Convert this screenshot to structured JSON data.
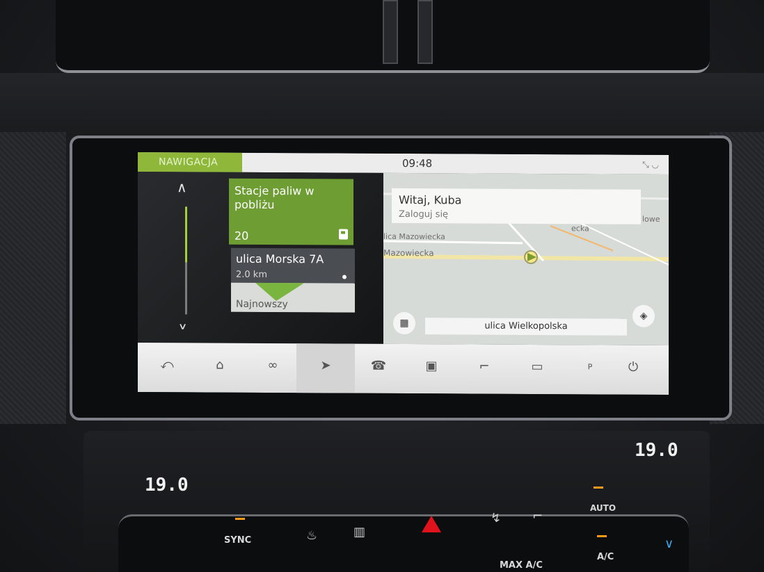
{
  "status": {
    "tab": "NAWIGACJA",
    "time": "09:48",
    "icons": "⤡ ◡"
  },
  "sidebar": {
    "up_icon": "chevron-up-icon",
    "down_icon": "chevron-down-icon",
    "scroll_fraction": 0.5
  },
  "cards": {
    "fuel": {
      "title": "Stacje paliw w pobliżu",
      "count": "20",
      "icon": "fuel-pump-icon"
    },
    "recent": {
      "title": "ulica Morska 7A",
      "distance": "2.0 km",
      "label": "Najnowszy"
    }
  },
  "map": {
    "greeting": "Witaj, Kuba",
    "login": "Zaloguj się",
    "street_labels": [
      "lica Mazowiecka",
      "Mazowiecka",
      "ecka",
      "lowe"
    ],
    "current_street": "ulica Wielkopolska",
    "grid_icon": "grid-icon",
    "layers_icon": "layers-icon"
  },
  "nav": {
    "items": [
      {
        "name": "back",
        "glyph": "⤺"
      },
      {
        "name": "home",
        "glyph": "⌂"
      },
      {
        "name": "connect",
        "glyph": "∞"
      },
      {
        "name": "navigation",
        "glyph": "➤"
      },
      {
        "name": "phone",
        "glyph": "☎"
      },
      {
        "name": "media",
        "glyph": "▣"
      },
      {
        "name": "seat",
        "glyph": "⌐"
      },
      {
        "name": "camera",
        "glyph": "▭"
      },
      {
        "name": "parking",
        "glyph": "P"
      },
      {
        "name": "power",
        "glyph": "⏻"
      }
    ],
    "parking_label": "P"
  },
  "climate": {
    "left_temp": "19.0",
    "right_temp": "19.0",
    "sync": "SYNC",
    "auto": "AUTO",
    "max_ac": "MAX A/C",
    "ac": "A/C"
  },
  "colors": {
    "accent": "#8fb83b",
    "fuel_card": "#6e9d34",
    "hazard": "#e0121c"
  }
}
